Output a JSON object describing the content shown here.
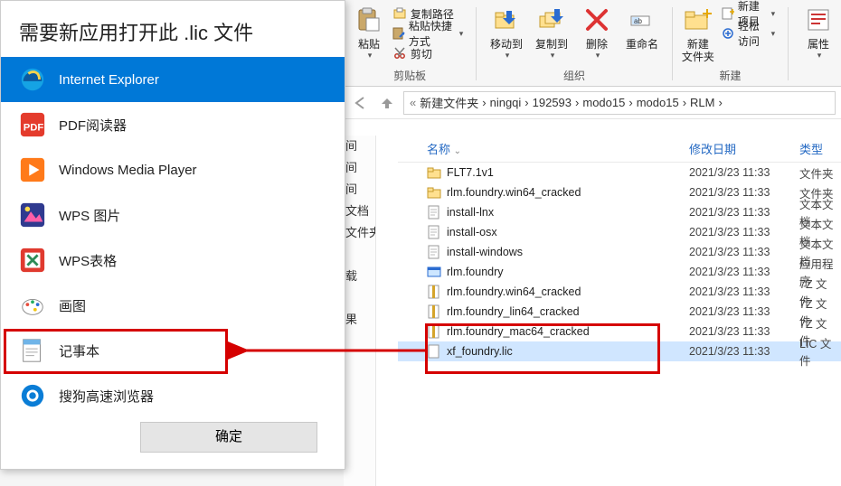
{
  "openwith": {
    "title": "需要新应用打开此 .lic 文件",
    "apps": [
      {
        "label": "Internet Explorer",
        "selected": true,
        "icon": "ie"
      },
      {
        "label": "PDF阅读器",
        "icon": "pdf"
      },
      {
        "label": "Windows Media Player",
        "icon": "wmp"
      },
      {
        "label": "WPS 图片",
        "icon": "wpspic"
      },
      {
        "label": "WPS表格",
        "icon": "wpssht"
      },
      {
        "label": "画图",
        "icon": "paint"
      },
      {
        "label": "记事本",
        "icon": "notepad"
      },
      {
        "label": "搜狗高速浏览器",
        "icon": "sogou"
      }
    ],
    "ok_label": "确定"
  },
  "ribbon": {
    "clipboard": {
      "label": "剪贴板",
      "paste": "粘贴",
      "copy_path": "复制路径",
      "paste_shortcut": "粘贴快捷方式",
      "cut": "剪切"
    },
    "organize": {
      "label": "组织",
      "move_to": "移动到",
      "copy_to": "复制到",
      "delete": "删除",
      "rename": "重命名"
    },
    "new": {
      "label": "新建",
      "new_folder": "新建\n文件夹",
      "new_item": "新建项目",
      "easy_access": "轻松访问"
    },
    "properties": "属性"
  },
  "breadcrumbs": {
    "leadin": "«",
    "parts": [
      "新建文件夹",
      "ningqi",
      "192593",
      "modo15",
      "modo15",
      "RLM"
    ]
  },
  "tree_clip": [
    "间",
    "间",
    "间",
    "文档",
    "文件夹",
    "",
    "载",
    "",
    "果"
  ],
  "columns": {
    "name": "名称",
    "date": "修改日期",
    "type": "类型"
  },
  "files": [
    {
      "name": "FLT7.1v1",
      "date": "2021/3/23 11:33",
      "type": "文件夹",
      "icon": "folder"
    },
    {
      "name": "rlm.foundry.win64_cracked",
      "date": "2021/3/23 11:33",
      "type": "文件夹",
      "icon": "folder"
    },
    {
      "name": "install-lnx",
      "date": "2021/3/23 11:33",
      "type": "文本文档",
      "icon": "txt"
    },
    {
      "name": "install-osx",
      "date": "2021/3/23 11:33",
      "type": "文本文档",
      "icon": "txt"
    },
    {
      "name": "install-windows",
      "date": "2021/3/23 11:33",
      "type": "文本文档",
      "icon": "txt"
    },
    {
      "name": "rlm.foundry",
      "date": "2021/3/23 11:33",
      "type": "应用程序",
      "icon": "exe"
    },
    {
      "name": "rlm.foundry.win64_cracked",
      "date": "2021/3/23 11:33",
      "type": "7Z 文件",
      "icon": "7z"
    },
    {
      "name": "rlm.foundry_lin64_cracked",
      "date": "2021/3/23 11:33",
      "type": "7Z 文件",
      "icon": "7z"
    },
    {
      "name": "rlm.foundry_mac64_cracked",
      "date": "2021/3/23 11:33",
      "type": "7Z 文件",
      "icon": "7z"
    },
    {
      "name": "xf_foundry.lic",
      "date": "2021/3/23 11:33",
      "type": "LIC 文件",
      "icon": "file",
      "selected": true
    }
  ]
}
